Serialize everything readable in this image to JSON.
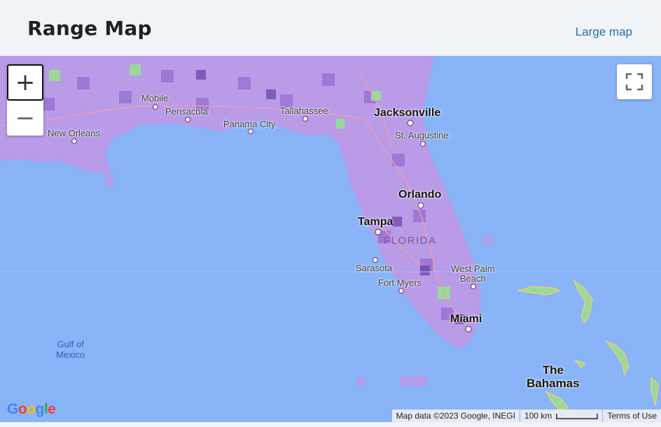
{
  "header": {
    "title": "Range Map",
    "large_map_link": "Large map"
  },
  "map": {
    "zoom_in_label": "+",
    "zoom_out_label": "−",
    "fullscreen_icon": "fullscreen-icon",
    "water_label": "Gulf of\nMexico",
    "cities": [
      {
        "name": "Mobile"
      },
      {
        "name": "Pensacola"
      },
      {
        "name": "New Orleans"
      },
      {
        "name": "Tallahassee"
      },
      {
        "name": "Panama City"
      },
      {
        "name": "Jacksonville"
      },
      {
        "name": "St. Augustine"
      },
      {
        "name": "Orlando"
      },
      {
        "name": "Tampa"
      },
      {
        "name": "Sarasota"
      },
      {
        "name": "Fort Myers"
      },
      {
        "name": "West Palm\nBeach"
      },
      {
        "name": "Miami"
      }
    ],
    "state_label": "FLORIDA",
    "country_label": "The\nBahamas",
    "logo_text": "Google",
    "footer": {
      "map_data": "Map data ©2023 Google, INEGI",
      "scale": "100 km",
      "terms": "Terms of Use"
    },
    "colors": {
      "water": "#8ab4f8",
      "range_purple": "#a77be0",
      "range_dark": "#6b3fa3",
      "land_green": "#9bd89a"
    }
  }
}
